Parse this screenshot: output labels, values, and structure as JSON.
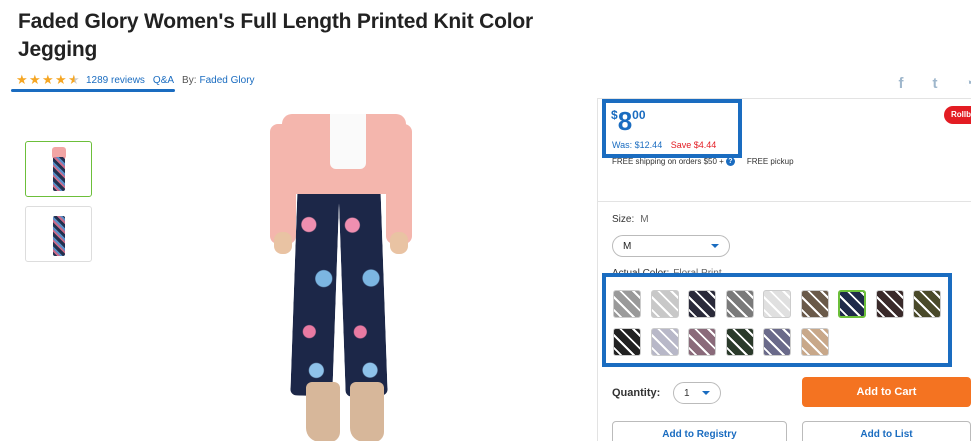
{
  "product": {
    "title": "Faded Glory Women's Full Length Printed Knit Color Jegging",
    "rating": 4.5,
    "reviews_label": "1289 reviews",
    "qa_label": "Q&A",
    "by_label": "By:",
    "brand": "Faded Glory"
  },
  "share": {
    "icons": [
      "facebook-icon",
      "twitter-icon",
      "more-icon"
    ]
  },
  "badge": {
    "rollback": "Rollb"
  },
  "price": {
    "currency": "$",
    "dollars": "8",
    "cents": "00",
    "was": "Was: $12.44",
    "save": "Save $4.44",
    "shipping": "FREE shipping on orders $50 +",
    "pickup": "FREE pickup"
  },
  "size": {
    "label": "Size:",
    "current": "M",
    "selected": "M"
  },
  "color": {
    "label": "Actual Color:",
    "current": "Floral Print",
    "swatches": [
      "#9a9a9a",
      "#c8c8c8",
      "#2a2a3a",
      "#7a7a7a",
      "#e0e0e0",
      "#6a5a4a",
      "#1f2a4a",
      "#3a2a2a",
      "#4a4a2a",
      "#222222",
      "#b8b8c8",
      "#8a6a7a",
      "#2a3a2a",
      "#6a6a8a",
      "#c8a88a"
    ],
    "selected_index": 6
  },
  "quantity": {
    "label": "Quantity:",
    "value": "1"
  },
  "actions": {
    "add_to_cart": "Add to Cart",
    "add_to_registry": "Add to Registry",
    "add_to_list": "Add to List"
  },
  "colors": {
    "accent": "#1a6cc0",
    "cta": "#f47321",
    "rollback": "#e31c23",
    "star": "#f5a623"
  }
}
